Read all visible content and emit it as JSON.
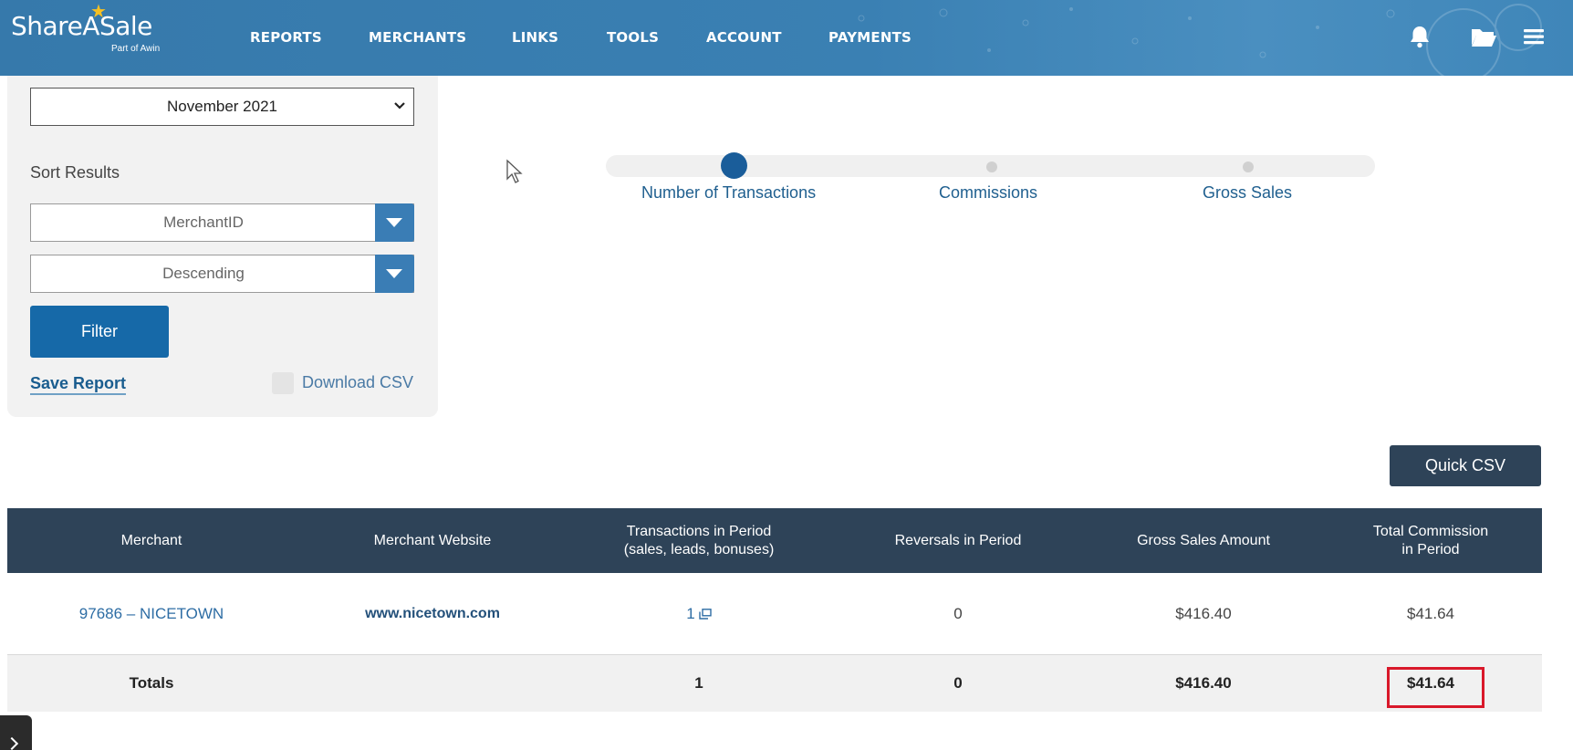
{
  "brand": {
    "name": "ShareASale",
    "tagline": "Part of Awin"
  },
  "nav": {
    "items": [
      "REPORTS",
      "MERCHANTS",
      "LINKS",
      "TOOLS",
      "ACCOUNT",
      "PAYMENTS"
    ],
    "icons": [
      "bell-icon",
      "folder-icon",
      "menu-icon"
    ]
  },
  "filters": {
    "period_value": "November 2021",
    "sort_label": "Sort Results",
    "sort_field": "MerchantID",
    "sort_order": "Descending",
    "filter_button": "Filter",
    "save_report": "Save Report",
    "download_csv": "Download CSV",
    "download_csv_checked": false
  },
  "chart_tabs": {
    "tabs": [
      "Number of Transactions",
      "Commissions",
      "Gross Sales"
    ],
    "active_index": 0
  },
  "table": {
    "quick_csv": "Quick CSV",
    "columns": [
      "Merchant",
      "Merchant Website",
      "Transactions in Period\n(sales, leads, bonuses)",
      "Reversals in Period",
      "Gross Sales Amount",
      "Total Commission\nin Period"
    ],
    "rows": [
      {
        "merchant": "97686 – NICETOWN",
        "website": "www.nicetown.com",
        "transactions": "1",
        "reversals": "0",
        "gross_sales": "$416.40",
        "commission": "$41.64"
      }
    ],
    "totals": {
      "label": "Totals",
      "transactions": "1",
      "reversals": "0",
      "gross_sales": "$416.40",
      "commission": "$41.64"
    }
  },
  "colors": {
    "nav_bg": "#3a80b3",
    "table_header_bg": "#2e4358",
    "primary_button": "#1669a8",
    "highlight_border": "#d9182a"
  }
}
